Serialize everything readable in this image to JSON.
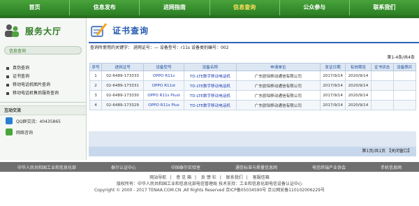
{
  "nav": [
    "首页",
    "信息发布",
    "进网指南",
    "信息查询",
    "公众参与",
    "联系我们"
  ],
  "sidebar": {
    "title": "服务大厅",
    "tab_label": "信息查询",
    "links": [
      "真伪查询",
      "证书查询",
      "移动电话机图片查询",
      "移动电话机售后服务查询"
    ],
    "interaction_title": "互动交流",
    "qq_label": "QQ群交流：40435865",
    "online_label": "网络咨询"
  },
  "main": {
    "title": "证书查询",
    "query_info": "查询所使用的关键字：  进网证号：—  设备型号：r11s  设备类别编号：002",
    "pager_top": "第1-4条/共4条",
    "columns": [
      "序号",
      "进网证号",
      "设备型号",
      "设备名称",
      "申请单位",
      "发证日期",
      "有效期至",
      "证书状态",
      "设备照片"
    ],
    "rows": [
      [
        "1",
        "02-6489-173333",
        "OPPO R11s",
        "TD-LTE数字移动电话机",
        "广东欧珀移动通信有限公司",
        "2017/9/14",
        "2020/9/14",
        "",
        ""
      ],
      [
        "2",
        "02-6489-173331",
        "OPPO R11st",
        "TD-LTE数字移动电话机",
        "广东欧珀移动通信有限公司",
        "2017/9/14",
        "2020/9/14",
        "",
        ""
      ],
      [
        "3",
        "02-6489-173330",
        "OPPO R11s Plust",
        "TD-LTE数字移动电话机",
        "广东欧珀移动通信有限公司",
        "2017/9/14",
        "2020/9/14",
        "",
        ""
      ],
      [
        "4",
        "02-6489-173329",
        "OPPO R11s Plus",
        "TD-LTE数字移动电话机",
        "广东欧珀移动通信有限公司",
        "2017/9/14",
        "2020/9/14",
        "",
        ""
      ]
    ],
    "pager_bottom": "第1页/共1页",
    "close_label": "【关闭窗口】"
  },
  "links_bar": [
    "中华人民共和国工业和信息化部",
    "泰尔认证中心",
    "中国泰尔实验室",
    "通信标准与质量信息网",
    "电信终端产业协会",
    "手机信息网"
  ],
  "footer": {
    "links": [
      "网站导航",
      "意 见 箱",
      "反 馈 栏",
      "联系我们",
      "客服信箱"
    ],
    "line1": "版权所有：中华人民共和国工业和信息化部电信管理局   技术支持：工业和信息化部电信设备认证中心",
    "line2": "Copyright © 2000 - 2017 TENAA.COM.CN ,All Rights Reserved  京ICP备05034590号 京公网安备110102006229号"
  },
  "colors": {
    "nav_green": "#2b7f24",
    "title_blue": "#2559b1",
    "sidebar_green": "#2f7b24"
  }
}
